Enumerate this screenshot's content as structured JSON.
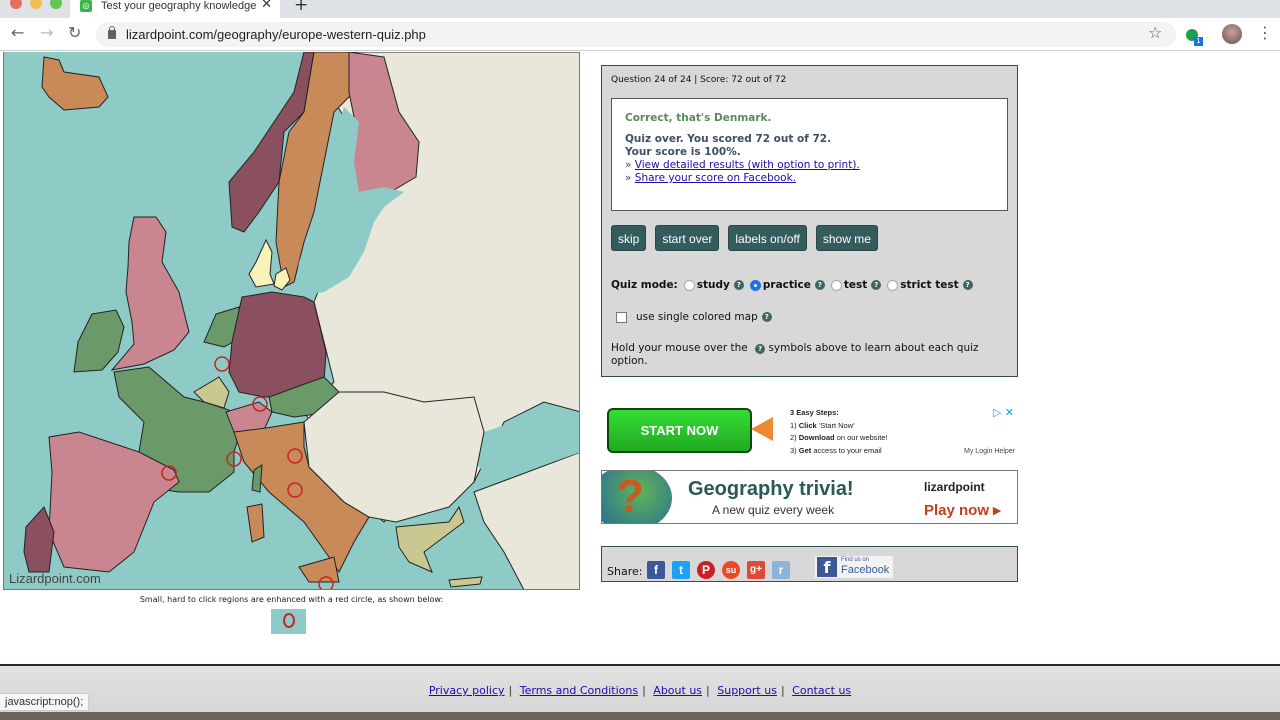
{
  "browser": {
    "tab_title": "Test your geography knowledge",
    "url": "lizardpoint.com/geography/europe-western-quiz.php",
    "extension_badge": "1",
    "status_url": "javascript:nop();"
  },
  "map": {
    "watermark": "Lizardpoint.com",
    "note": "Small, hard to click regions are enhanced with a red circle, as shown below:",
    "colors": {
      "sea": "#8fcbc6",
      "inactive": "#e8e7da",
      "green": "#6a9a6a",
      "pink": "#c98590",
      "maroon": "#8a5060",
      "tan": "#c98a5a",
      "khaki": "#c8c890",
      "highlight": "#f6f2b8",
      "circle": "#cc2222"
    }
  },
  "quiz": {
    "status": "Question 24 of 24 | Score: 72 out of 72",
    "correct_msg": "Correct, that's Denmark.",
    "score_line1": "Quiz over. You scored 72 out of 72.",
    "score_line2": "Your score is 100%.",
    "link_prefix": "»",
    "link_results": "View detailed results (with option to print).",
    "link_share": "Share your score on Facebook.",
    "buttons": {
      "skip": "skip",
      "start_over": "start over",
      "labels": "labels on/off",
      "show_me": "show me"
    },
    "mode_label": "Quiz mode:",
    "modes": [
      {
        "label": "study",
        "selected": false
      },
      {
        "label": "practice",
        "selected": true
      },
      {
        "label": "test",
        "selected": false
      },
      {
        "label": "strict test",
        "selected": false
      }
    ],
    "single_color_label": "use single colored map",
    "single_color_checked": false,
    "hold_note_before": "Hold your mouse over the",
    "hold_note_after": "symbols above to learn about each quiz option.",
    "help_glyph": "?"
  },
  "ad1": {
    "button": "START NOW",
    "steps_title": "3 Easy Steps:",
    "step1_bold": "Click",
    "step1_rest": " 'Start Now'",
    "step2_bold": "Download",
    "step2_rest": " on our website!",
    "step3_bold": "Get",
    "step3_rest": " access to your email",
    "brand": "My Login Helper",
    "adchoices": "▷ ✕"
  },
  "ad2": {
    "title": "Geography trivia!",
    "subtitle": "A new quiz every week",
    "logo": "lizardpoint",
    "cta": "Play now ▸",
    "qmark": "?"
  },
  "share": {
    "label": "Share:",
    "icons": [
      {
        "name": "facebook",
        "glyph": "f",
        "color": "#3b5998"
      },
      {
        "name": "twitter",
        "glyph": "t",
        "color": "#1da1f2"
      },
      {
        "name": "pinterest",
        "glyph": "P",
        "color": "#cb2027"
      },
      {
        "name": "stumbleupon",
        "glyph": "su",
        "color": "#eb4924"
      },
      {
        "name": "google-plus",
        "glyph": "g+",
        "color": "#dd4b39"
      },
      {
        "name": "reddit",
        "glyph": "r",
        "color": "#8ab4d8"
      }
    ],
    "find_us_small": "Find us on",
    "find_us_big": "Facebook"
  },
  "footer": {
    "links": [
      "Privacy policy",
      "Terms and Conditions",
      "About us",
      "Support us",
      "Contact us"
    ],
    "separator": "|"
  }
}
